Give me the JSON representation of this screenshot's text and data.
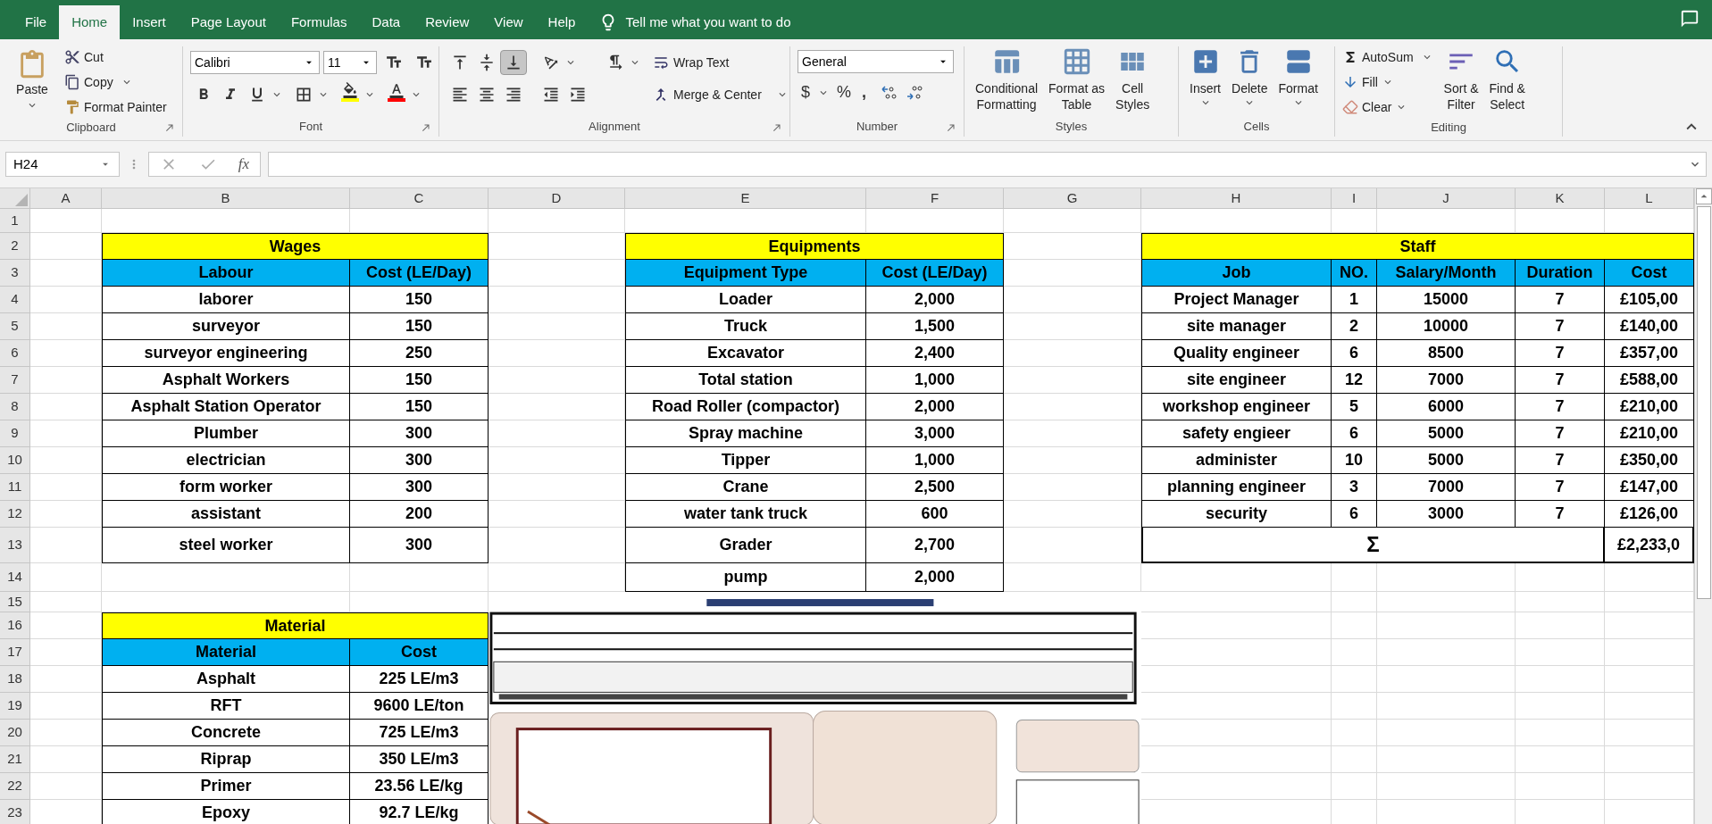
{
  "ribbon_tabs": [
    {
      "label": "File",
      "selected": false
    },
    {
      "label": "Home",
      "selected": true
    },
    {
      "label": "Insert",
      "selected": false
    },
    {
      "label": "Page Layout",
      "selected": false
    },
    {
      "label": "Formulas",
      "selected": false
    },
    {
      "label": "Data",
      "selected": false
    },
    {
      "label": "Review",
      "selected": false
    },
    {
      "label": "View",
      "selected": false
    },
    {
      "label": "Help",
      "selected": false
    }
  ],
  "tell_me": "Tell me what you want to do",
  "ribbon": {
    "clipboard": {
      "label": "Clipboard",
      "paste": "Paste",
      "cut": "Cut",
      "copy": "Copy",
      "format_painter": "Format Painter"
    },
    "font": {
      "label": "Font",
      "font_name": "Calibri",
      "font_size": "11"
    },
    "alignment": {
      "label": "Alignment",
      "wrap_text": "Wrap Text",
      "merge_center": "Merge & Center",
      "vertical_align": [
        {
          "selected": false
        },
        {
          "selected": false
        },
        {
          "selected": true
        }
      ]
    },
    "number": {
      "label": "Number",
      "format": "General",
      "currency": "$",
      "percent": "%",
      "comma": ","
    },
    "styles": {
      "label": "Styles",
      "buttons": [
        "Conditional\nFormatting",
        "Format as\nTable",
        "Cell\nStyles"
      ]
    },
    "cells": {
      "label": "Cells",
      "buttons": [
        "Insert",
        "Delete",
        "Format"
      ]
    },
    "editing": {
      "label": "Editing",
      "autosum": "AutoSum",
      "fill": "Fill",
      "clear": "Clear",
      "sort_filter": "Sort &\nFilter",
      "find_select": "Find &\nSelect"
    }
  },
  "formula_bar": {
    "name_box": "H24",
    "function_symbol": "fx"
  },
  "sheet": {
    "columns": [
      "A",
      "B",
      "C",
      "D",
      "E",
      "F",
      "G",
      "H",
      "I",
      "J",
      "K",
      "L"
    ],
    "rows": [
      "1",
      "2",
      "3",
      "4",
      "5",
      "6",
      "7",
      "8",
      "9",
      "10",
      "11",
      "12",
      "13",
      "14",
      "15",
      "16",
      "17",
      "18",
      "19",
      "20",
      "21",
      "22",
      "23"
    ],
    "wages": {
      "title": "Wages",
      "columns": [
        "Labour",
        "Cost (LE/Day)"
      ],
      "rows": [
        [
          "laborer",
          "150"
        ],
        [
          "surveyor",
          "150"
        ],
        [
          "surveyor engineering",
          "250"
        ],
        [
          "Asphalt Workers",
          "150"
        ],
        [
          "Asphalt Station Operator",
          "150"
        ],
        [
          "Plumber",
          "300"
        ],
        [
          "electrician",
          "300"
        ],
        [
          "form worker",
          "300"
        ],
        [
          "assistant",
          "200"
        ],
        [
          "steel worker",
          "300"
        ]
      ]
    },
    "equipments": {
      "title": "Equipments",
      "columns": [
        "Equipment Type",
        "Cost (LE/Day)"
      ],
      "rows": [
        [
          "Loader",
          "2,000"
        ],
        [
          "Truck",
          "1,500"
        ],
        [
          "Excavator",
          "2,400"
        ],
        [
          "Total station",
          "1,000"
        ],
        [
          "Road Roller (compactor)",
          "2,000"
        ],
        [
          "Spray machine",
          "3,000"
        ],
        [
          "Tipper",
          "1,000"
        ],
        [
          "Crane",
          "2,500"
        ],
        [
          "water tank truck",
          "600"
        ],
        [
          "Grader",
          "2,700"
        ],
        [
          "pump",
          "2,000"
        ]
      ]
    },
    "staff": {
      "title": "Staff",
      "columns": [
        "Job",
        "NO.",
        "Salary/Month",
        "Duration",
        "Cost"
      ],
      "rows": [
        [
          "Project Manager",
          "1",
          "15000",
          "7",
          "£105,00"
        ],
        [
          "site manager",
          "2",
          "10000",
          "7",
          "£140,00"
        ],
        [
          "Quality engineer",
          "6",
          "8500",
          "7",
          "£357,00"
        ],
        [
          "site engineer",
          "12",
          "7000",
          "7",
          "£588,00"
        ],
        [
          "workshop engineer",
          "5",
          "6000",
          "7",
          "£210,00"
        ],
        [
          "safety engieer",
          "6",
          "5000",
          "7",
          "£210,00"
        ],
        [
          "administer",
          "10",
          "5000",
          "7",
          "£350,00"
        ],
        [
          "planning engineer",
          "3",
          "7000",
          "7",
          "£147,00"
        ],
        [
          "security",
          "6",
          "3000",
          "7",
          "£126,00"
        ]
      ],
      "total": {
        "symbol": "Σ",
        "value": "£2,233,0"
      }
    },
    "material": {
      "title": "Material",
      "columns": [
        "Material",
        "Cost"
      ],
      "rows": [
        [
          "Asphalt",
          "225 LE/m3"
        ],
        [
          "RFT",
          "9600 LE/ton"
        ],
        [
          "Concrete",
          "725 LE/m3"
        ],
        [
          "Riprap",
          "350 LE/m3"
        ],
        [
          "Primer",
          "23.56 LE/kg"
        ],
        [
          "Epoxy",
          "92.7 LE/kg"
        ]
      ]
    }
  }
}
